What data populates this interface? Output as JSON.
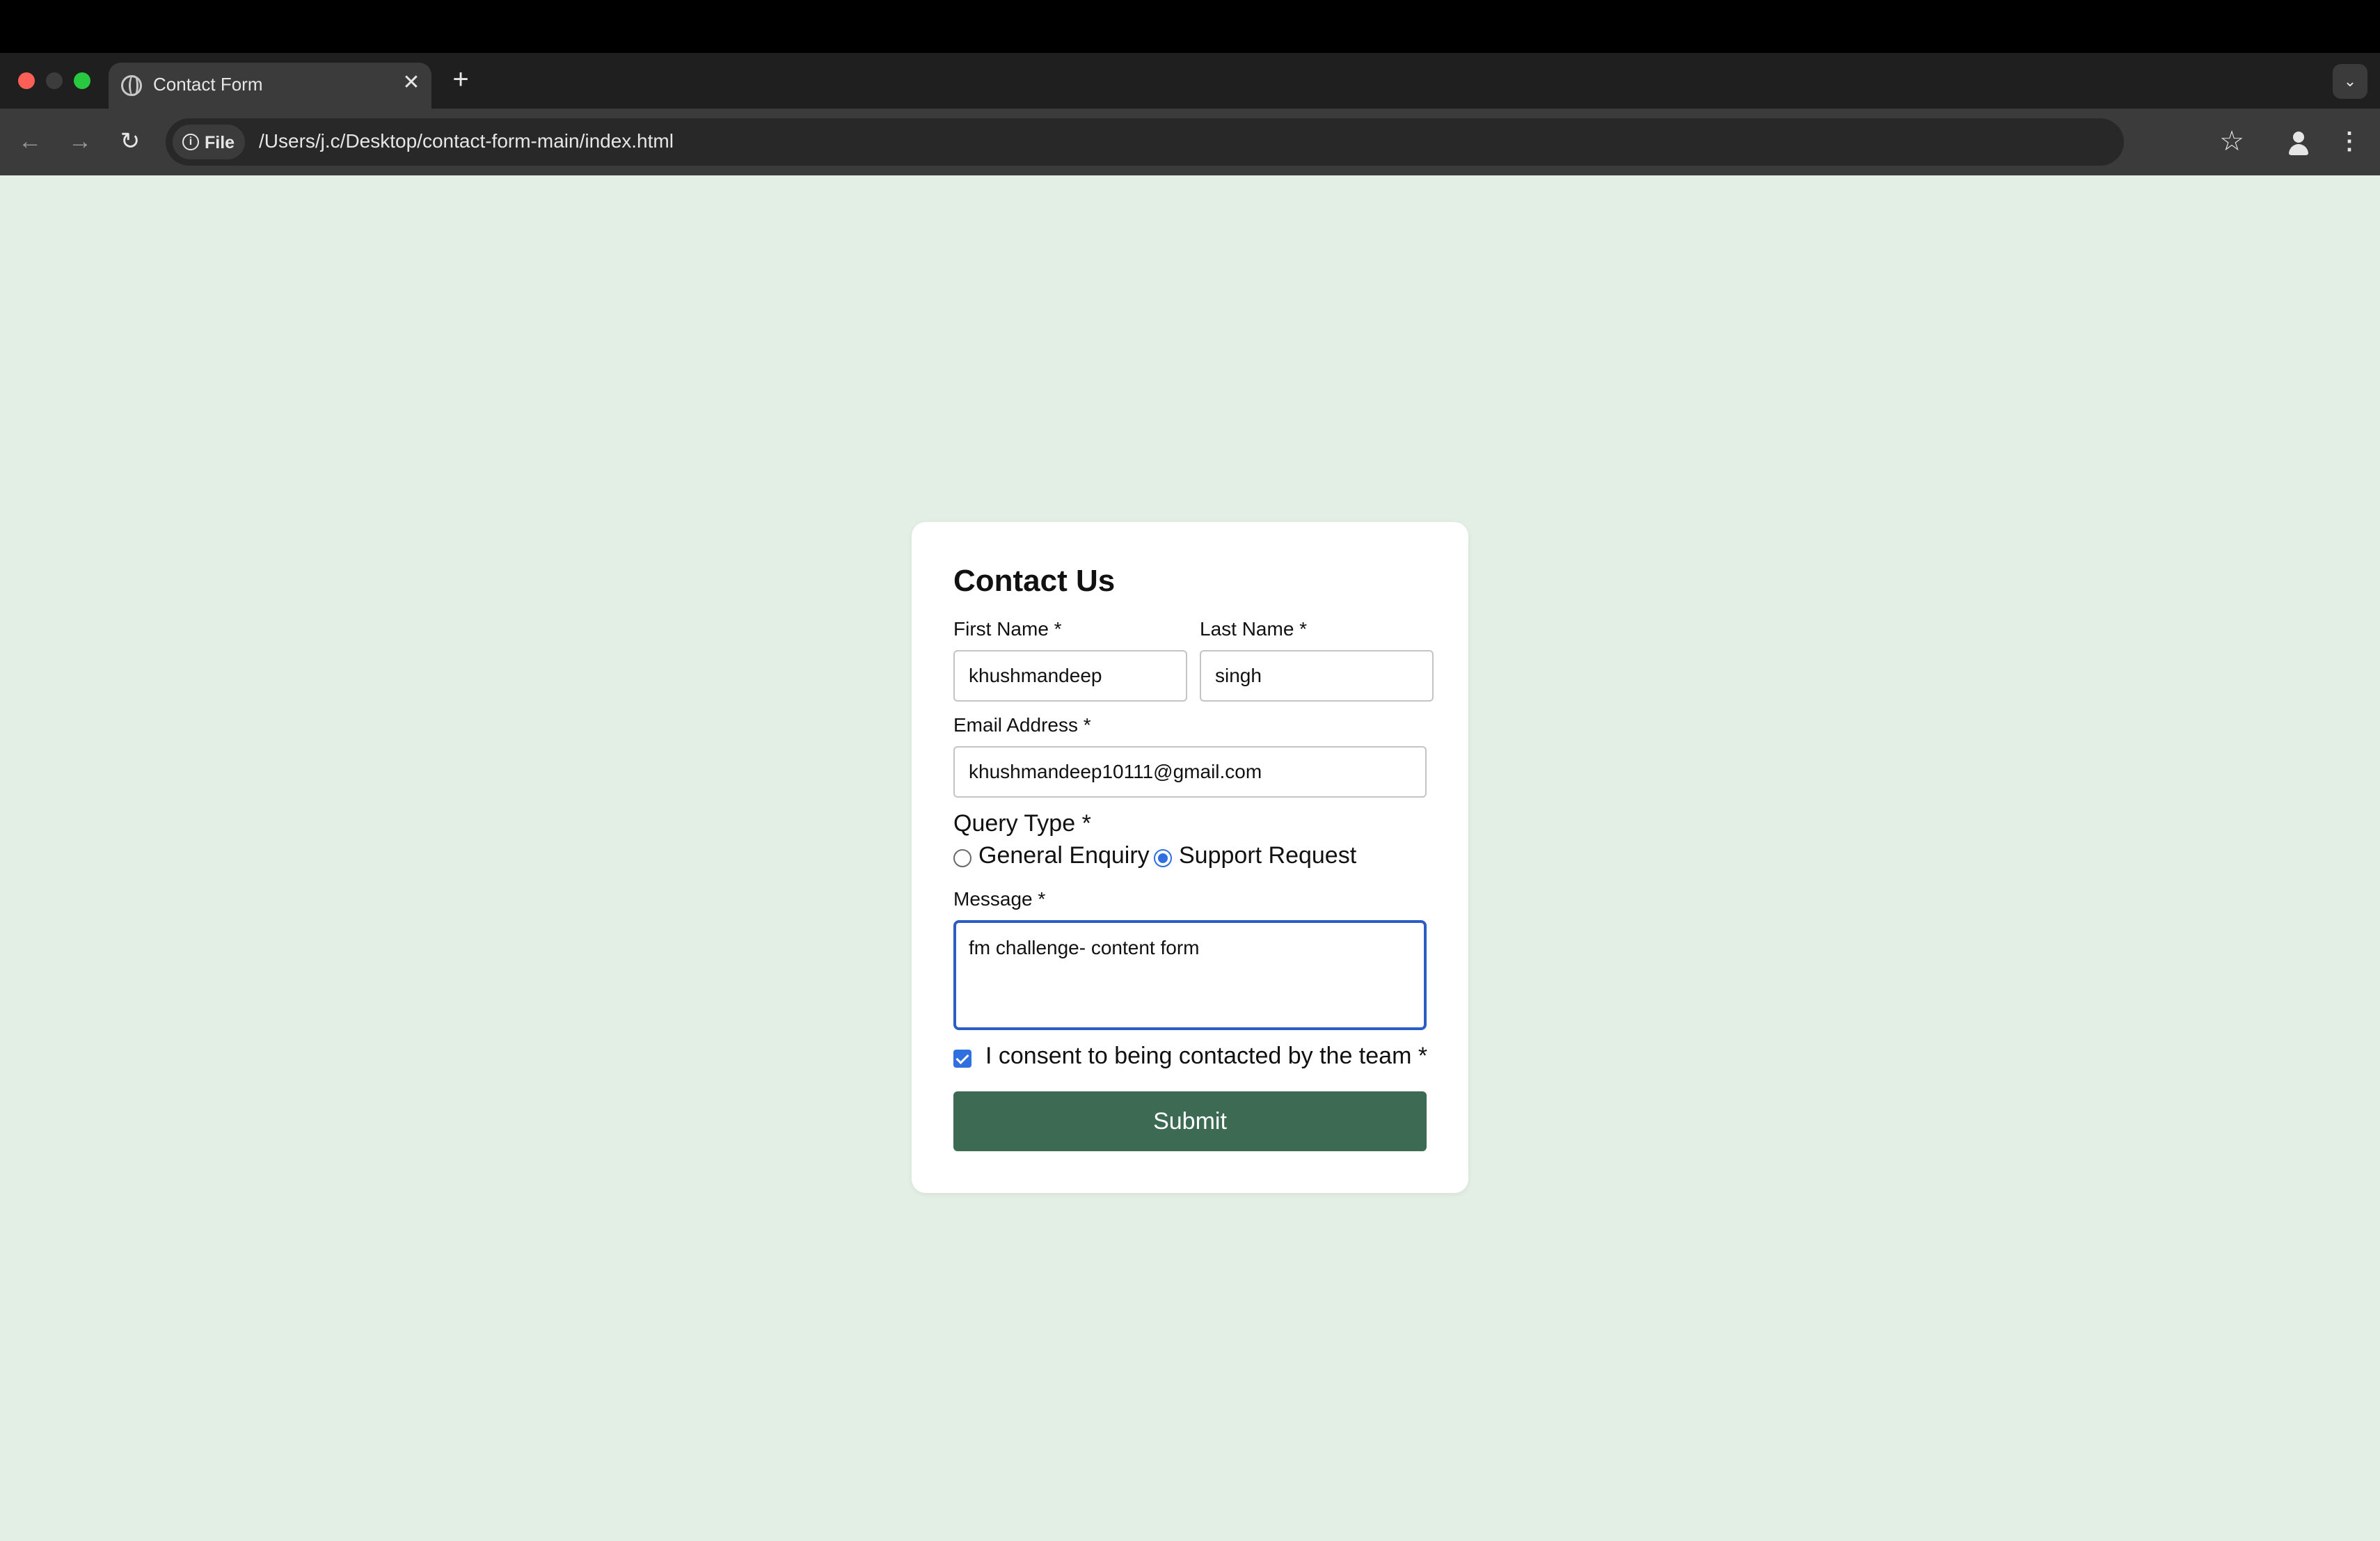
{
  "browser": {
    "tab_title": "Contact Form",
    "tab_close": "✕",
    "new_tab": "+",
    "tab_menu": "⌄",
    "file_chip": "File",
    "url": "/Users/j.c/Desktop/contact-form-main/index.html",
    "icons": [
      "back-arrow-icon",
      "forward-arrow-icon",
      "reload-icon",
      "info-icon",
      "star-icon",
      "profile-icon",
      "menu-kebab-icon"
    ]
  },
  "form": {
    "title": "Contact Us",
    "first_name_label": "First Name *",
    "first_name_value": "khushmandeep",
    "last_name_label": "Last Name *",
    "last_name_value": "singh",
    "email_label": "Email Address *",
    "email_value": "khushmandeep10111@gmail.com",
    "query_type_label": "Query Type *",
    "query_options": [
      {
        "label": "General Enquiry",
        "selected": false
      },
      {
        "label": "Support Request",
        "selected": true
      }
    ],
    "message_label": "Message *",
    "message_value": "fm challenge- content form",
    "consent_label": "I consent to being contacted by the team *",
    "consent_checked": true,
    "submit_label": "Submit"
  },
  "colors": {
    "page_background": "#e3eee4",
    "submit_button": "#3d6a53",
    "focus_border": "#2b5dc7",
    "radio_checked": "#2f6fe0"
  }
}
